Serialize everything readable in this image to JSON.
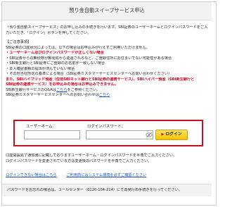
{
  "title": "預り金自動スイープサービス申込",
  "intro": [
    "「預り金自動スイープサービス」のお申し込みの手続きを行います。SBI証券のユーザーネームとログインパスワードをご入",
    "力いただき、「ログイン」ボタンを押してください。"
  ],
  "notice": {
    "heading": "【ご注意事項】",
    "lead": "SBI証券の口座状況によっては、以下の場合はお申込みが行えずご利用いただけません。",
    "alert": "・ユーザーネーム及びログインパスワードが正しくない場合",
    "items": [
      "・SBI証券からの郵便物が郵便局から返還されるなど、ご登録住所にお住まいでない可能性がある場合",
      "・SBI新生銀行とSBI証券にご登録のお名前が一致しない場合",
      "・本人確認書類の提出が済んでいない場合",
      "・その他当社所定の基準による場合（SBI証券カスタマーサービスセンターへお問い合わせください）"
    ],
    "hybrid_lines": [
      "また、SBIハイブリッド預金（住信SBIネット銀行とSBI証券の連携サービス）、SBIハイパー預金（SBI新生銀行と",
      "SBI証券の連携サービス）をお申込みの場合はお申込みできません。"
    ],
    "contact_pre": "SBI新生銀行サービスのQ&Aは",
    "contact_link": "こちら",
    "contact_post": "をご参照ください。",
    "center_pre": "SBI証券カスタマーサービスセンターへのお問い合わせは",
    "center_link": "こちら"
  },
  "login": {
    "username_label": "ユーザーネーム：",
    "password_label": "ログインパスワード：",
    "button_label": "ログイン"
  },
  "lower": [
    "口座開設完了通知書に記載しておりますユーザーネーム・ログインパスワードを半角でご入力ください。",
    "ログインパスワードを変更されている方は変更後のパスワードを半角でご入力ください。"
  ],
  "links": {
    "forgot": "ログインできない場合はこちら",
    "requirements": "ご利用前にはシステム環境を必ずご確認ください"
  },
  "footer": "パスワードをお忘れの場合は、コールセンター（0120-104-214）にて再発行の手続きを行ってください。"
}
